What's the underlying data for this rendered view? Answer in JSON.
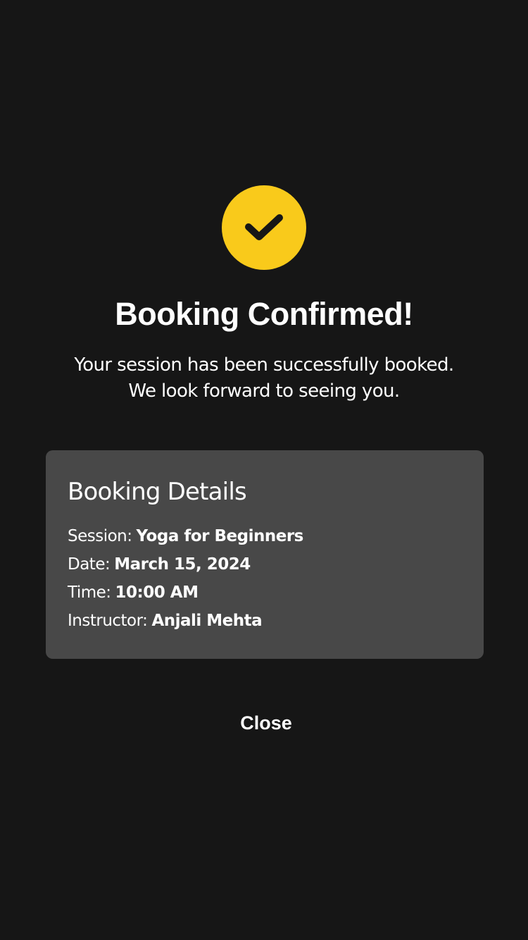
{
  "header": {
    "icon": "checkmark-icon",
    "accent_color": "#F9CA1B",
    "title": "Booking Confirmed!"
  },
  "message": {
    "line1": "Your session has been successfully booked.",
    "line2": "We look forward to seeing you."
  },
  "details": {
    "heading": "Booking Details",
    "session": {
      "label": "Session:",
      "value": "Yoga for Beginners"
    },
    "date": {
      "label": "Date:",
      "value": "March 15, 2024"
    },
    "time": {
      "label": "Time:",
      "value": "10:00 AM"
    },
    "instructor": {
      "label": "Instructor:",
      "value": "Anjali Mehta"
    }
  },
  "actions": {
    "close_label": "Close"
  },
  "colors": {
    "background": "#161616",
    "card": "#484848",
    "text": "#FFFFFF",
    "icon_mark": "#161616"
  }
}
